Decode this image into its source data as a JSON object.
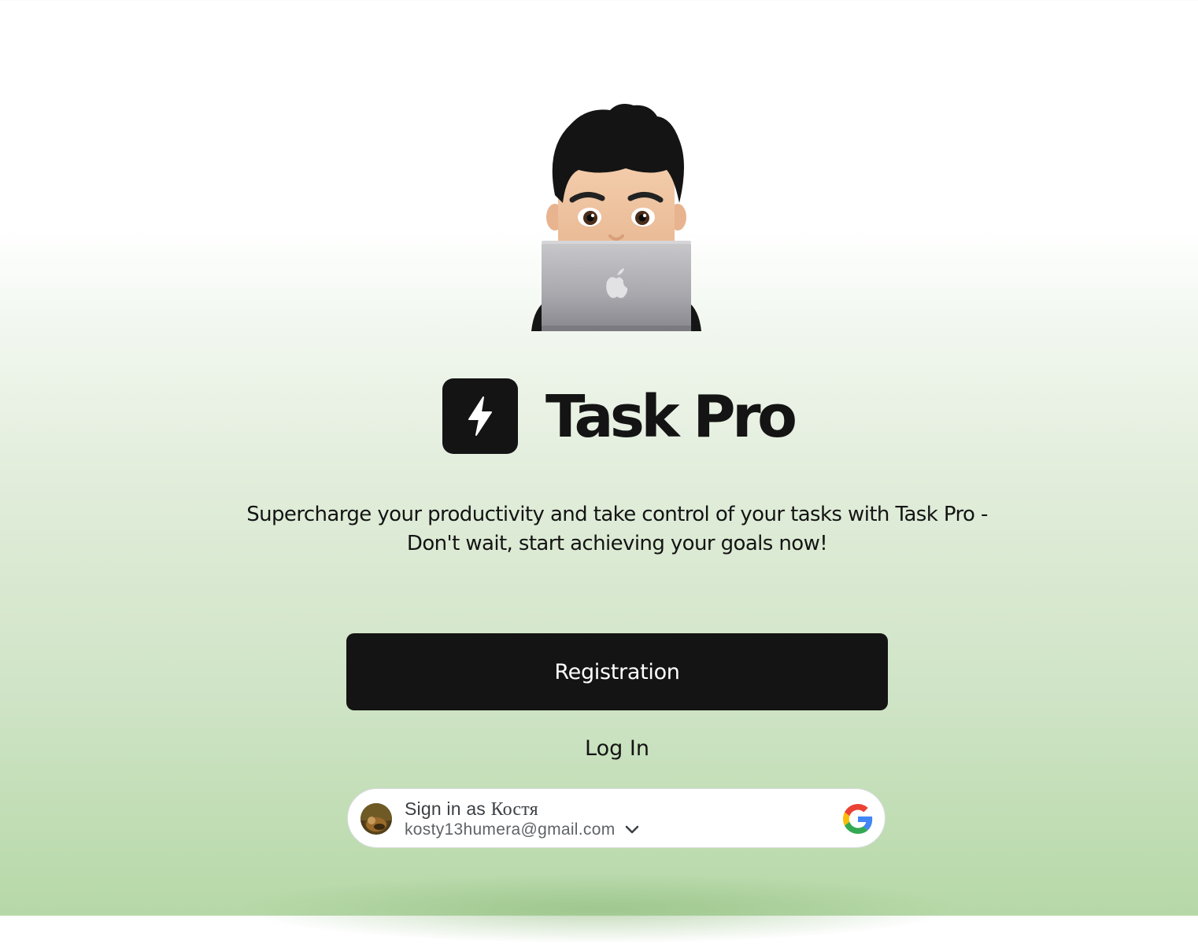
{
  "brand": {
    "title": "Task Pro",
    "icon": "lightning-icon"
  },
  "hero": {
    "image": "memoji-with-laptop"
  },
  "tagline": "Supercharge your productivity and take control of your tasks with Task Pro - Don't wait, start achieving your goals now!",
  "actions": {
    "register_label": "Registration",
    "login_label": "Log In"
  },
  "google_signin": {
    "prefix": "Sign in as",
    "name": "Костя",
    "email": "kosty13humera@gmail.com",
    "icon": "google-logo-icon"
  },
  "colors": {
    "primary": "#141414",
    "background_top": "#ffffff",
    "background_bottom": "#b6d8a7"
  }
}
